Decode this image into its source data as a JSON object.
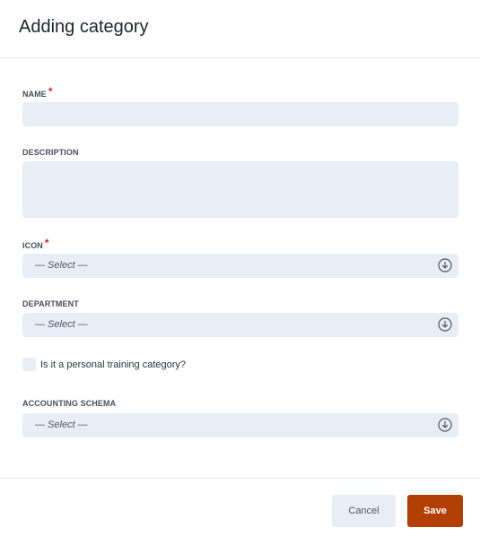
{
  "dialog": {
    "title": "Adding category",
    "required_marker": "*"
  },
  "fields": {
    "name": {
      "label": "NAME",
      "value": ""
    },
    "description": {
      "label": "DESCRIPTION",
      "value": ""
    },
    "icon": {
      "label": "ICON",
      "selected": "— Select —"
    },
    "department": {
      "label": "DEPARTMENT",
      "selected": "— Select —"
    },
    "personal_training": {
      "label": "Is it a personal training category?",
      "checked": false
    },
    "accounting_schema": {
      "label": "ACCOUNTING SCHEMA",
      "selected": "— Select —"
    }
  },
  "footer": {
    "cancel_label": "Cancel",
    "save_label": "Save"
  },
  "colors": {
    "save_button": "#b13f06",
    "field_background": "#e7eef6",
    "required": "#d0262f"
  }
}
